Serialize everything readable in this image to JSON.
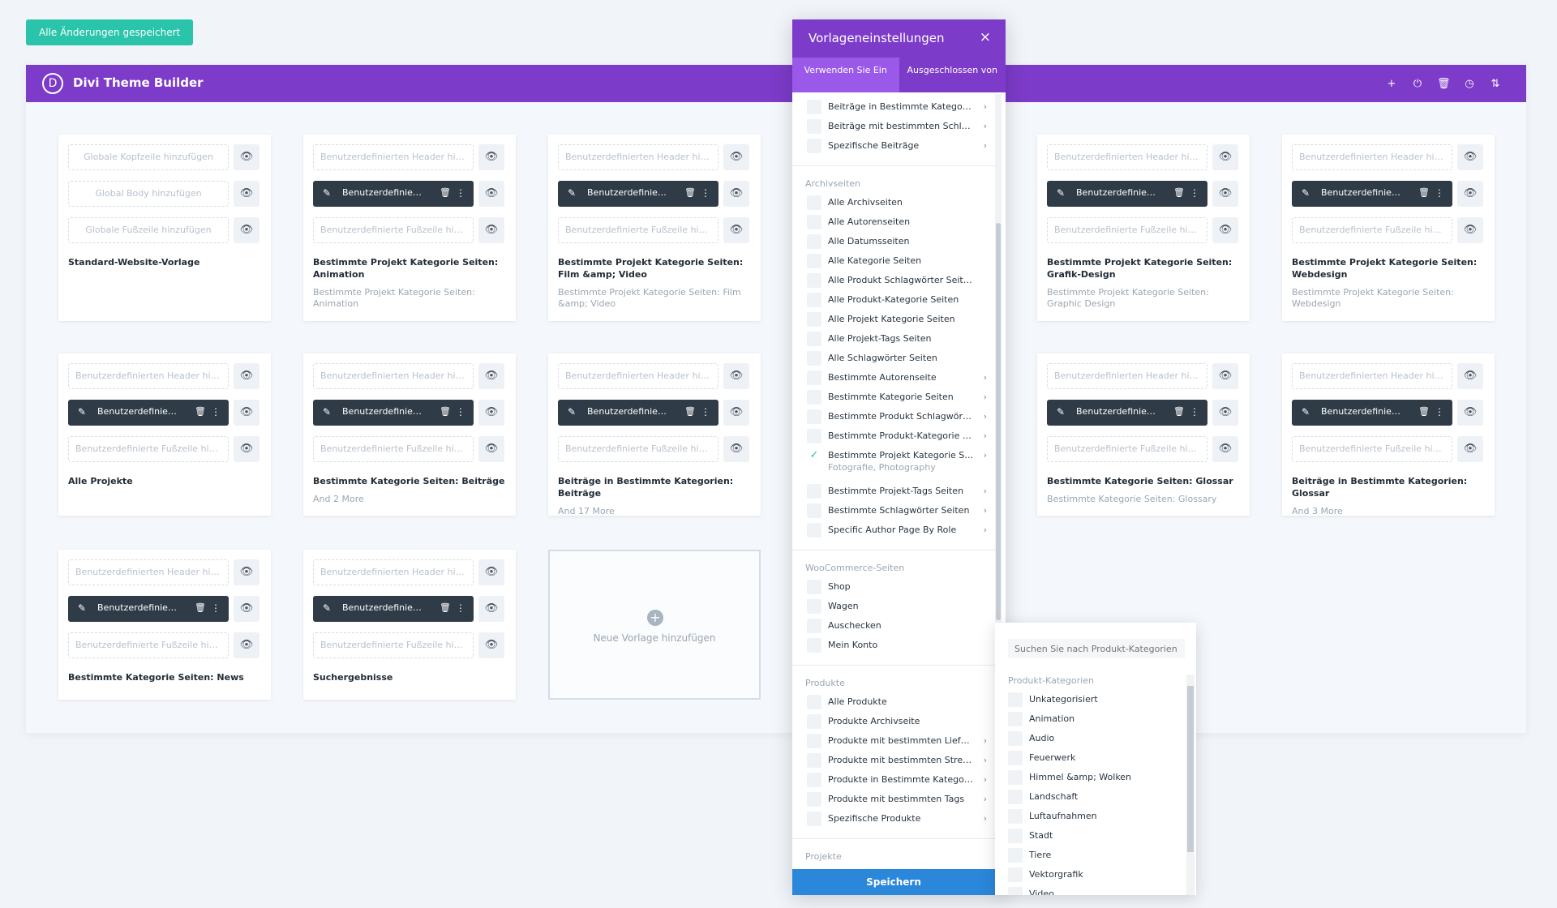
{
  "top": {
    "save_all_label": "Alle Änderungen gespeichert"
  },
  "builder": {
    "logo_letter": "D",
    "title": "Divi Theme Builder",
    "icons": {
      "add": "+",
      "power": "⏻",
      "trash": "🗑",
      "history": "◷",
      "sort": "⇅"
    }
  },
  "cards": [
    {
      "header": "Globale Kopfzeile hinzufügen",
      "body": "Global Body hinzufügen",
      "footer": "Globale Fußzeile hinzufügen",
      "name": "Standard-Website-Vorlage",
      "sub": ""
    },
    {
      "header": "Benutzerdefinierten Header hinz...",
      "body": "Benutzerdefinierter ...",
      "footer": "Benutzerdefinierte Fußzeile hinz...",
      "name": "Bestimmte Projekt Kategorie Seiten: Animation",
      "sub": "Bestimmte Projekt Kategorie Seiten: Animation"
    },
    {
      "header": "Benutzerdefinierten Header hinz...",
      "body": "Benutzerdefinierter ...",
      "footer": "Benutzerdefinierte Fußzeile hinz...",
      "name": "Bestimmte Projekt Kategorie Seiten: Film &amp; Video",
      "sub": "Bestimmte Projekt Kategorie Seiten: Film &amp; Video"
    },
    {
      "header": "Benutzerdefinierten Header hinz...",
      "body": "Benutzerdefinierter ...",
      "footer": "Benutzerdefinierte Fußzeile hinz...",
      "name": "Bestimmte Projekt Kategorie Seiten: Grafik-Design",
      "sub": "Bestimmte Projekt Kategorie Seiten: Graphic Design"
    },
    {
      "header": "Benutzerdefinierten Header hinz...",
      "body": "Benutzerdefinierter ...",
      "footer": "Benutzerdefinierte Fußzeile hinz...",
      "name": "Bestimmte Projekt Kategorie Seiten: Webdesign",
      "sub": "Bestimmte Projekt Kategorie Seiten: Webdesign"
    },
    {
      "header": "Benutzerdefinierten Header hinz...",
      "body": "Benutzerdefinierter ...",
      "footer": "Benutzerdefinierte Fußzeile hinz...",
      "name": "Alle Projekte",
      "sub": ""
    },
    {
      "header": "Benutzerdefinierten Header hinz...",
      "body": "Benutzerdefinierter ...",
      "footer": "Benutzerdefinierte Fußzeile hinz...",
      "name": "Bestimmte Kategorie Seiten: Beiträge",
      "sub": "And 2 More"
    },
    {
      "header": "Benutzerdefinierten Header hinz...",
      "body": "Benutzerdefinierter ...",
      "footer": "Benutzerdefinierte Fußzeile hinz...",
      "name": "Beiträge in Bestimmte Kategorien: Beiträge",
      "sub": "And 17 More"
    },
    {
      "header": "Benutzerdefinierten Header hinz...",
      "body": "Benutzerdefinierter ...",
      "footer": "Benutzerdefinierte Fußzeile hinz...",
      "name": "Bestimmte Kategorie Seiten: Glossar",
      "sub": "Bestimmte Kategorie Seiten: Glossary"
    },
    {
      "header": "Benutzerdefinierten Header hinz...",
      "body": "Benutzerdefinierter ...",
      "footer": "Benutzerdefinierte Fußzeile hinz...",
      "name": "Beiträge in Bestimmte Kategorien: Glossar",
      "sub": "And 3 More"
    },
    {
      "header": "Benutzerdefinierten Header hinz...",
      "body": "Benutzerdefinierter ...",
      "footer": "Benutzerdefinierte Fußzeile hinz...",
      "name": "Bestimmte Kategorie Seiten: News",
      "sub": ""
    },
    {
      "header": "Benutzerdefinierten Header hinz...",
      "body": "Benutzerdefinierter ...",
      "footer": "Benutzerdefinierte Fußzeile hinz...",
      "name": "Suchergebnisse",
      "sub": ""
    }
  ],
  "new_template": {
    "label": "Neue Vorlage hinzufügen"
  },
  "modal": {
    "title": "Vorlageneinstellungen",
    "close": "×",
    "tab_use": "Verwenden Sie Ein",
    "tab_excluded": "Ausgeschlossen von",
    "save": "Speichern",
    "items_top": [
      {
        "label": "Beiträge in Bestimmte Kategorien",
        "chevron": "›"
      },
      {
        "label": "Beiträge mit bestimmten Schlagw...",
        "chevron": "›"
      },
      {
        "label": "Spezifische Beiträge",
        "chevron": "›"
      }
    ],
    "section_archive": "Archivseiten",
    "items_archive": [
      {
        "label": "Alle Archivseiten",
        "chevron": ""
      },
      {
        "label": "Alle Autorenseiten",
        "chevron": ""
      },
      {
        "label": "Alle Datumsseiten",
        "chevron": ""
      },
      {
        "label": "Alle Kategorie Seiten",
        "chevron": ""
      },
      {
        "label": "Alle Produkt Schlagwörter Seiten",
        "chevron": ""
      },
      {
        "label": "Alle Produkt-Kategorie Seiten",
        "chevron": ""
      },
      {
        "label": "Alle Projekt Kategorie Seiten",
        "chevron": ""
      },
      {
        "label": "Alle Projekt-Tags Seiten",
        "chevron": ""
      },
      {
        "label": "Alle Schlagwörter Seiten",
        "chevron": ""
      },
      {
        "label": "Bestimmte Autorenseite",
        "chevron": "›"
      },
      {
        "label": "Bestimmte Kategorie Seiten",
        "chevron": "›"
      },
      {
        "label": "Bestimmte Produkt Schlagwörter ...",
        "chevron": "›"
      },
      {
        "label": "Bestimmte Produkt-Kategorie Seit...",
        "chevron": "›"
      },
      {
        "label": "Bestimmte Projekt Kategorie Seiten",
        "chevron": "›",
        "checked": true
      }
    ],
    "selected_sub": "Fotografie, Photography",
    "items_archive2": [
      {
        "label": "Bestimmte Projekt-Tags Seiten",
        "chevron": "›"
      },
      {
        "label": "Bestimmte Schlagwörter Seiten",
        "chevron": "›"
      },
      {
        "label": "Specific Author Page By Role",
        "chevron": "›"
      }
    ],
    "section_woo": "WooCommerce-Seiten",
    "items_woo": [
      {
        "label": "Shop",
        "chevron": ""
      },
      {
        "label": "Wagen",
        "chevron": ""
      },
      {
        "label": "Auschecken",
        "chevron": ""
      },
      {
        "label": "Mein Konto",
        "chevron": ""
      }
    ],
    "section_products": "Produkte",
    "items_products": [
      {
        "label": "Alle Produkte",
        "chevron": ""
      },
      {
        "label": "Produkte Archivseite",
        "chevron": ""
      },
      {
        "label": "Produkte mit bestimmten Lieferze...",
        "chevron": "›"
      },
      {
        "label": "Produkte mit bestimmten Streich...",
        "chevron": "›"
      },
      {
        "label": "Produkte in Bestimmte Kategorien",
        "chevron": "›"
      },
      {
        "label": "Produkte mit bestimmten Tags",
        "chevron": "›"
      },
      {
        "label": "Spezifische Produkte",
        "chevron": "›"
      }
    ],
    "section_projects": "Projekte"
  },
  "flyout": {
    "search_placeholder": "Suchen Sie nach Produkt-Kategorien",
    "title": "Produkt-Kategorien",
    "items": [
      "Unkategorisiert",
      "Animation",
      "Audio",
      "Feuerwerk",
      "Himmel &amp; Wolken",
      "Landschaft",
      "Luftaufnahmen",
      "Stadt",
      "Tiere",
      "Vektorgrafik",
      "Video"
    ]
  }
}
